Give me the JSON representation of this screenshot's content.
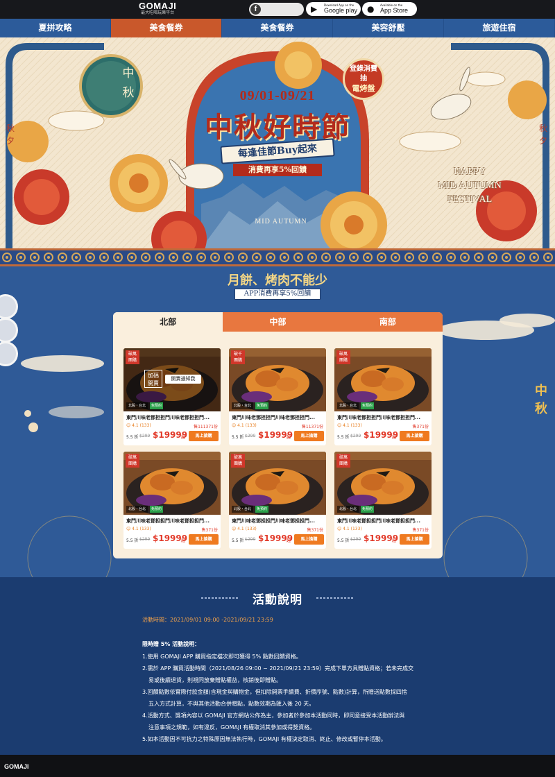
{
  "header": {
    "logo": "GOMAJI",
    "logo_tagline": "最大吃喝玩樂平台",
    "facebook_glyph": "f",
    "google_play": {
      "small": "Download App on the",
      "big": "Google play"
    },
    "app_store": {
      "small": "Available on the",
      "big": "App Store"
    }
  },
  "nav": {
    "items": [
      {
        "label": "夏拼攻略"
      },
      {
        "label": "美食餐券"
      },
      {
        "label": "美食餐券"
      },
      {
        "label": "美容舒壓"
      },
      {
        "label": "旅遊住宿"
      }
    ],
    "active_index": 1
  },
  "banner": {
    "date": "09/01-09/21",
    "title": "中秋好時節",
    "ribbon": "每逢佳節Buy起來",
    "subtitle": "消費再享5%回饋",
    "badge_line1": "登錄消費",
    "badge_line2": "抽",
    "badge_line3": "電烤盤",
    "happy_line1": "HAPPY",
    "happy_line2": "MID AUTUMN",
    "happy_line3": "FESTIVAL",
    "mid_autumn": "MID AUTUMN",
    "zhongqiu": "中秋",
    "qiuxi": "秋夕"
  },
  "section": {
    "title": "月餅、烤肉不能少",
    "subtitle": "APP消費再享5%回饋",
    "side_text": "中秋",
    "tabs": [
      {
        "label": "北部"
      },
      {
        "label": "中部"
      },
      {
        "label": "南部"
      }
    ],
    "active_tab": 0
  },
  "products": [
    {
      "badge": "破萬\n團購",
      "location": "北股・台北",
      "reserve": "免預約",
      "title": "東門川味老鄧担担門川味老鄧担担門...",
      "rating": "4.1 (133)",
      "sold": "售111371份",
      "discount": "5.5 折",
      "original": "$299",
      "price": "$19999",
      "unit": "起",
      "buy": "馬上搶購",
      "overlay": {
        "tag": "加碼\n開賣",
        "button": "開賣通知我"
      }
    },
    {
      "badge": "破千\n團購",
      "location": "北股・台北",
      "reserve": "免預約",
      "title": "東門川味老鄧担担門川味老鄧担担門...",
      "rating": "4.1 (133)",
      "sold": "售11371份",
      "discount": "5.5 折",
      "original": "$299",
      "price": "$19999",
      "unit": "起",
      "buy": "馬上搶購"
    },
    {
      "badge": "破萬\n團購",
      "location": "北股・台北",
      "reserve": "免預約",
      "title": "東門川味老鄧担担門川味老鄧担担門...",
      "rating": "4.1 (133)",
      "sold": "售371份",
      "discount": "5.5 折",
      "original": "$299",
      "price": "$19999",
      "unit": "起",
      "buy": "馬上搶購"
    },
    {
      "badge": "破萬\n團購",
      "location": "北股・台北",
      "reserve": "免預約",
      "title": "東門川味老鄧担担門川味老鄧担担門...",
      "rating": "4.1 (133)",
      "sold": "售371份",
      "discount": "5.5 折",
      "original": "$299",
      "price": "$19999",
      "unit": "起",
      "buy": "馬上搶購"
    },
    {
      "badge": "破萬\n團購",
      "location": "北股・台北",
      "reserve": "免預約",
      "title": "東門川味老鄧担担門川味老鄧担担門...",
      "rating": "4.1 (133)",
      "sold": "售371份",
      "discount": "5.5 折",
      "original": "$299",
      "price": "$19999",
      "unit": "起",
      "buy": "馬上搶購"
    },
    {
      "badge": "破萬\n團購",
      "location": "北股・台北",
      "reserve": "免預約",
      "title": "東門川味老鄧担担門川味老鄧担担門...",
      "rating": "4.1 (133)",
      "sold": "售371份",
      "discount": "5.5 折",
      "original": "$299",
      "price": "$19999",
      "unit": "起",
      "buy": "馬上搶購"
    }
  ],
  "activity": {
    "title": "活動說明",
    "time": "活動時間：2021/09/01 09:00 -2021/09/21 23:59",
    "heading": "限時贈 5% 活動說明：",
    "items": [
      {
        "text": "1.使用 GOMAJI APP 購買指定檔次即可獲得 5% 點數回饋資格。"
      },
      {
        "text": "2.需於 APP 購買活動時間（2021/08/26 09:00 ~ 2021/09/21 23:59）完成下單方具贈點資格；若未完成交",
        "cont": "易或後續退貨，則視同放棄贈點權益，核銷後即贈點。"
      },
      {
        "text": "3.回饋點數依實際付款金額(含現金與購物金，但扣除開票手續費、折價序號、點數)計算，所贈送點數採四捨",
        "cont": "五入方式計算，不與其他活動合併贈點，點數效期為匯入後 20 天。"
      },
      {
        "text": "4.活動方式、獎項內容以 GOMAJI 官方網站公佈為主，參加者於參加本活動同時，即同意接受本活動辦法與",
        "cont": "注意事項之規範，如有違反，GOMAJI 有權取消其參加或得獎資格。"
      },
      {
        "text": "5.如本活動因不可抗力之特殊原因無法執行時，GOMAJI 有權決定取消、終止、修改或暫停本活動。"
      }
    ]
  },
  "footer": {
    "logo": "GOMAJI"
  },
  "colors": {
    "nav_active": "#c9582b",
    "accent_orange": "#ef7a20",
    "price_red": "#e23a2a",
    "section_blue": "#2f5a97",
    "dark_blue": "#1b3c70"
  }
}
